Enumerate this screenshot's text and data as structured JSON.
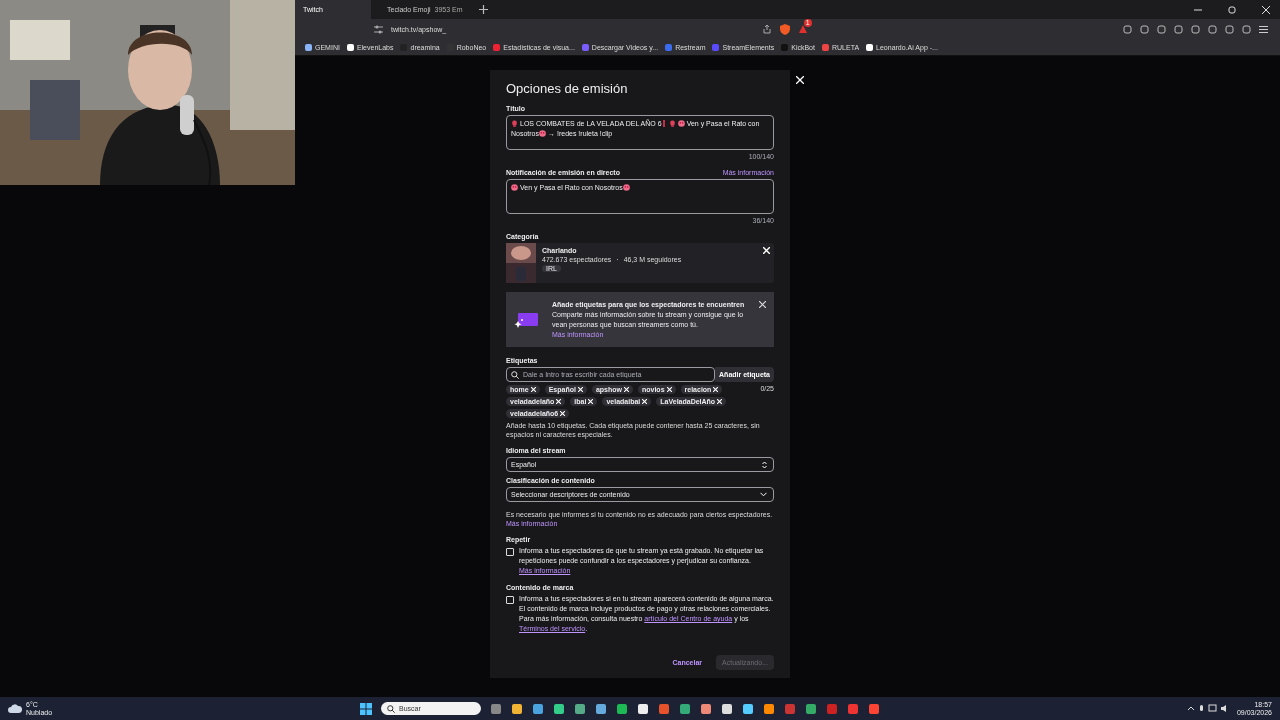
{
  "browser": {
    "tabs": [
      {
        "title": "Twitch",
        "selected": true
      },
      {
        "title": "Teclado Emoji",
        "extra": "3953 Em",
        "selected": false
      }
    ],
    "address": "twitch.tv/apshow_",
    "notification_count": "1",
    "bookmarks": [
      {
        "label": "GEMINI"
      },
      {
        "label": "ElevenLabs"
      },
      {
        "label": "dreamina"
      },
      {
        "label": "RoboNeo"
      },
      {
        "label": "Estadísticas de visua..."
      },
      {
        "label": "Descargar Videos y..."
      },
      {
        "label": "Restream"
      },
      {
        "label": "StreamElements"
      },
      {
        "label": "KickBot"
      },
      {
        "label": "RULETA"
      },
      {
        "label": "Leonardo.Ai App -..."
      }
    ]
  },
  "modal": {
    "title": "Opciones de emisión",
    "title_field": {
      "label": "Título",
      "parts": [
        {
          "kind": "glove"
        },
        {
          "kind": "text",
          "text": "LOS COMBATES de LA VELADA DEL AÑO 6"
        },
        {
          "kind": "bar"
        },
        {
          "kind": "glove"
        },
        {
          "kind": "smiley"
        },
        {
          "kind": "text",
          "text": "Ven y Pasa el Rato con Nosotros"
        },
        {
          "kind": "smiley"
        },
        {
          "kind": "text",
          "text": "→ !redes !ruleta !clip"
        }
      ],
      "count": "100/140"
    },
    "notification_field": {
      "label": "Notificación de emisión en directo",
      "link": "Más información",
      "parts": [
        {
          "kind": "smiley"
        },
        {
          "kind": "text",
          "text": "Ven y Pasa el Rato con Nosotros"
        },
        {
          "kind": "smiley"
        }
      ],
      "count": "36/140"
    },
    "category": {
      "label": "Categoría",
      "name": "Charlando",
      "viewers": "472.673 espectadores",
      "separator": "·",
      "followers": "46,3 M seguidores",
      "tag": "IRL"
    },
    "banner": {
      "title": "Añade etiquetas para que los espectadores te encuentren",
      "body": "Comparte más información sobre tu stream y consigue que lo vean personas que buscan streamers como tú.",
      "link": "Más información"
    },
    "tags": {
      "label": "Etiquetas",
      "placeholder": "Dale a Intro tras escribir cada etiqueta",
      "add_button": "Añadir etiqueta",
      "count": "0/25",
      "items": [
        "home",
        "Español",
        "apshow",
        "novios",
        "relacion",
        "veladadelaño",
        "ibai",
        "veladaibai",
        "LaVeladaDelAño",
        "veladadelaño6"
      ],
      "hint": "Añade hasta 10 etiquetas. Cada etiqueta puede contener hasta 25 caracteres, sin espacios ni caracteres especiales."
    },
    "language": {
      "label": "Idioma del stream",
      "value": "Español"
    },
    "classification": {
      "label": "Clasificación de contenido",
      "value": "Seleccionar descriptores de contenido",
      "hint": "Es necesario que informes si tu contenido no es adecuado para ciertos espectadores.",
      "link": "Más información"
    },
    "options": [
      {
        "label": "Repetir",
        "checked": false,
        "text": "Informa a tus espectadores de que tu stream ya está grabado. No etiquetar las repeticiones puede confundir a los espectadores y perjudicar su confianza.",
        "links": [
          "Más información"
        ]
      },
      {
        "label": "Contenido de marca",
        "checked": false,
        "text": "Informa a tus espectadores si en tu stream aparecerá contenido de alguna marca. El contenido de marca incluye productos de pago y otras relaciones comerciales. Para más información, consulta nuestro",
        "links": [
          "artículo del Centro de ayuda",
          "Términos del servicio"
        ],
        "joins": [
          "y los",
          "."
        ]
      }
    ],
    "cancel": "Cancelar",
    "submit": {
      "label": "Actualizando...",
      "disabled": true
    }
  },
  "taskbar": {
    "temperature": "6°C",
    "weather": "Nublado",
    "search_placeholder": "Buscar",
    "time": "18:57",
    "date": "09/03/2026"
  }
}
